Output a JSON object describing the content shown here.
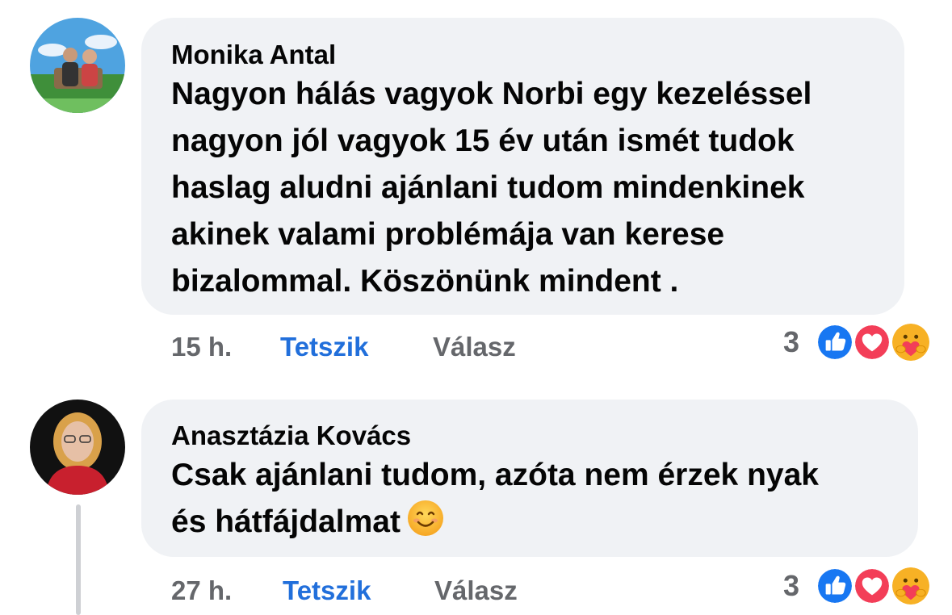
{
  "comments": [
    {
      "author": "Monika Antal",
      "text": "Nagyon hálás vagyok Norbi egy kezeléssel\nnagyon jól vagyok 15 év után ismét tudok\nhaslag aludni ajánlani tudom mindenkinek\nakinek valami problémája van kerese\nbizalommal. Köszönünk mindent .",
      "time": "15 h.",
      "like_label": "Tetszik",
      "reply_label": "Válasz",
      "reaction_count": "3",
      "reactions": [
        "like-icon",
        "love-icon",
        "care-icon"
      ]
    },
    {
      "author": "Anasztázia Kovács",
      "text": "Csak ajánlani tudom, azóta nem érzek nyak\nés hátfájdalmat",
      "text_emoji": "smiling-face-icon",
      "time": "27 h.",
      "like_label": "Tetszik",
      "reply_label": "Válasz",
      "reaction_count": "3",
      "reactions": [
        "like-icon",
        "love-icon",
        "care-icon"
      ]
    }
  ],
  "colors": {
    "bubble": "#f0f2f5",
    "like_text": "#216fdb",
    "muted_text": "#65676b",
    "like_reaction": "#1877f2",
    "love_reaction": "#f33e58",
    "care_reaction": "#f7b125"
  }
}
